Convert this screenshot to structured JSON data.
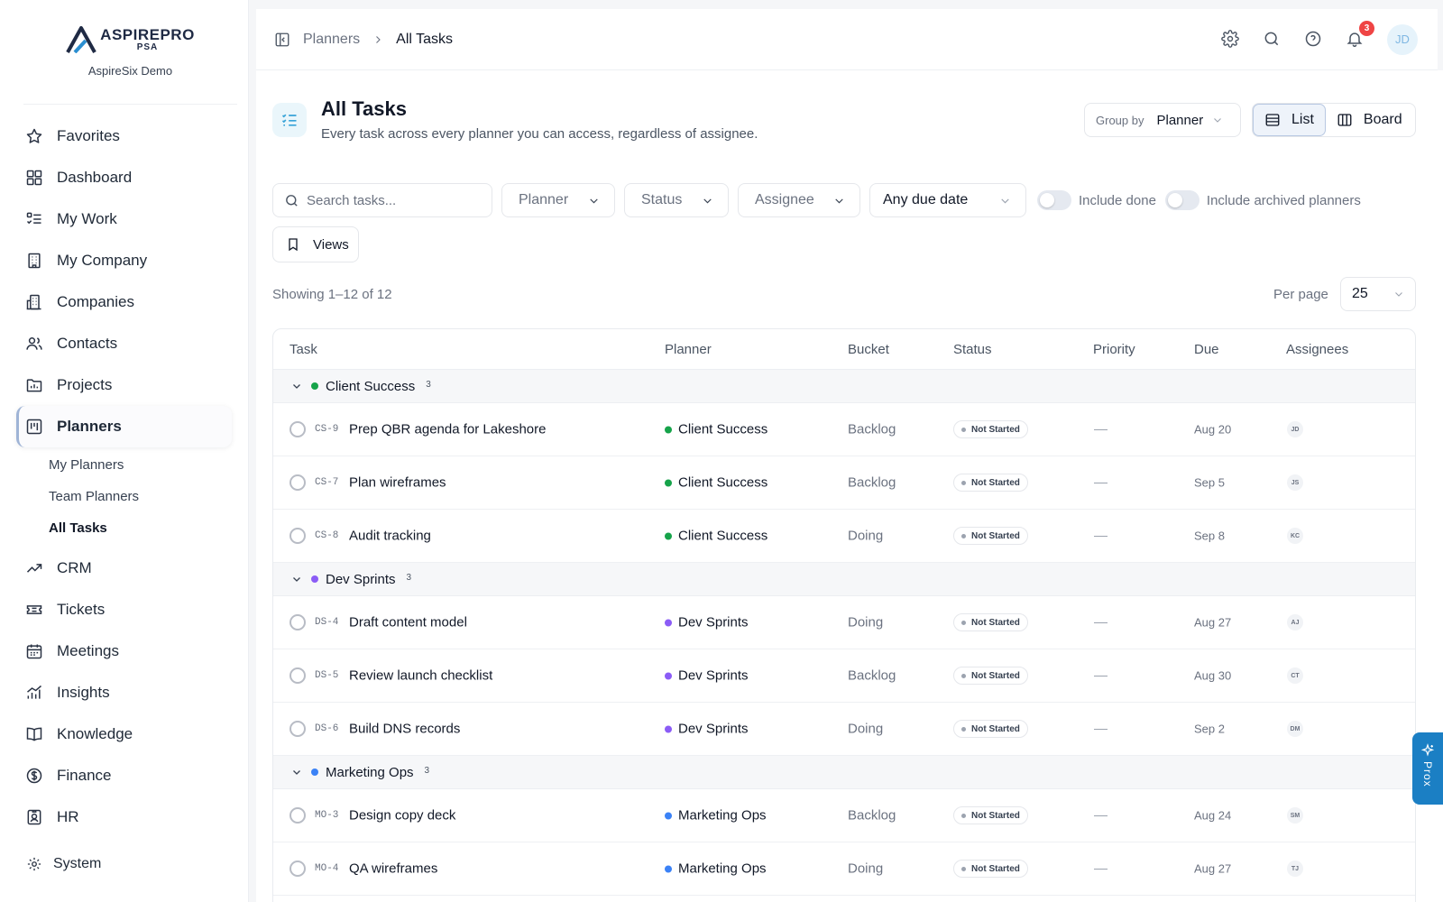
{
  "brand": {
    "name": "ASPIREPRO",
    "sub": "PSA",
    "workspace": "AspireSix Demo"
  },
  "sidebar": {
    "items": [
      {
        "label": "Favorites",
        "icon": "star-icon"
      },
      {
        "label": "Dashboard",
        "icon": "dashboard-icon"
      },
      {
        "label": "My Work",
        "icon": "checklist-icon"
      },
      {
        "label": "My Company",
        "icon": "building-icon"
      },
      {
        "label": "Companies",
        "icon": "buildings-icon"
      },
      {
        "label": "Contacts",
        "icon": "users-icon"
      },
      {
        "label": "Projects",
        "icon": "folder-chart-icon"
      },
      {
        "label": "Planners",
        "icon": "planner-icon"
      },
      {
        "label": "CRM",
        "icon": "trend-icon"
      },
      {
        "label": "Tickets",
        "icon": "ticket-icon"
      },
      {
        "label": "Meetings",
        "icon": "calendar-icon"
      },
      {
        "label": "Insights",
        "icon": "bar-chart-icon"
      },
      {
        "label": "Knowledge",
        "icon": "book-icon"
      },
      {
        "label": "Finance",
        "icon": "dollar-icon"
      },
      {
        "label": "HR",
        "icon": "id-badge-icon"
      },
      {
        "label": "System",
        "icon": "gear-icon"
      }
    ],
    "planner_sub": [
      "My Planners",
      "Team Planners",
      "All Tasks"
    ]
  },
  "topbar": {
    "breadcrumb": [
      "Planners",
      "All Tasks"
    ],
    "notifications_count": "3",
    "user_initials": "JD"
  },
  "page": {
    "title": "All Tasks",
    "subtitle": "Every task across every planner you can access, regardless of assignee.",
    "group_by_label": "Group by",
    "group_by_value": "Planner",
    "view_list": "List",
    "view_board": "Board",
    "active_view": "List"
  },
  "filters": {
    "search_placeholder": "Search tasks...",
    "planner": "Planner",
    "status": "Status",
    "assignee": "Assignee",
    "due": "Any due date",
    "include_done": "Include done",
    "include_archived": "Include archived planners",
    "views": "Views"
  },
  "summary": {
    "showing": "Showing 1–12 of 12",
    "per_page_label": "Per page",
    "per_page_value": "25"
  },
  "table": {
    "columns": [
      "Task",
      "Planner",
      "Bucket",
      "Status",
      "Priority",
      "Due",
      "Assignees"
    ],
    "groups": [
      {
        "name": "Client Success",
        "count": "3",
        "color": "#16a34a",
        "rows": [
          {
            "key": "CS-9",
            "title": "Prep QBR agenda for Lakeshore",
            "planner": "Client Success",
            "bucket": "Backlog",
            "status": "Not Started",
            "priority": "—",
            "due": "Aug 20",
            "assignee": "JD"
          },
          {
            "key": "CS-7",
            "title": "Plan wireframes",
            "planner": "Client Success",
            "bucket": "Backlog",
            "status": "Not Started",
            "priority": "—",
            "due": "Sep 5",
            "assignee": "JS"
          },
          {
            "key": "CS-8",
            "title": "Audit tracking",
            "planner": "Client Success",
            "bucket": "Doing",
            "status": "Not Started",
            "priority": "—",
            "due": "Sep 8",
            "assignee": "KC"
          }
        ]
      },
      {
        "name": "Dev Sprints",
        "count": "3",
        "color": "#8b5cf6",
        "rows": [
          {
            "key": "DS-4",
            "title": "Draft content model",
            "planner": "Dev Sprints",
            "bucket": "Doing",
            "status": "Not Started",
            "priority": "—",
            "due": "Aug 27",
            "assignee": "AJ"
          },
          {
            "key": "DS-5",
            "title": "Review launch checklist",
            "planner": "Dev Sprints",
            "bucket": "Backlog",
            "status": "Not Started",
            "priority": "—",
            "due": "Aug 30",
            "assignee": "CT"
          },
          {
            "key": "DS-6",
            "title": "Build DNS records",
            "planner": "Dev Sprints",
            "bucket": "Doing",
            "status": "Not Started",
            "priority": "—",
            "due": "Sep 2",
            "assignee": "DM"
          }
        ]
      },
      {
        "name": "Marketing Ops",
        "count": "3",
        "color": "#3b82f6",
        "rows": [
          {
            "key": "MO-3",
            "title": "Design copy deck",
            "planner": "Marketing Ops",
            "bucket": "Backlog",
            "status": "Not Started",
            "priority": "—",
            "due": "Aug 24",
            "assignee": "SM"
          },
          {
            "key": "MO-4",
            "title": "QA wireframes",
            "planner": "Marketing Ops",
            "bucket": "Doing",
            "status": "Not Started",
            "priority": "—",
            "due": "Aug 27",
            "assignee": "TJ"
          }
        ]
      }
    ]
  },
  "assistant": {
    "label": "Prox"
  }
}
